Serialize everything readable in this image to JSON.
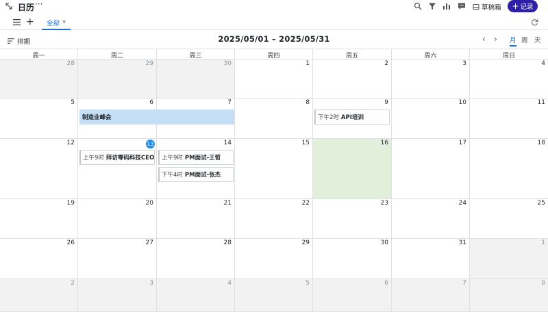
{
  "app": {
    "title": "日历",
    "more": "···"
  },
  "toolbar": {
    "drafts_label": "草稿箱",
    "record_label": "记录",
    "record_plus": "+"
  },
  "tabs": {
    "all_label": "全部",
    "caret": "▼"
  },
  "sortbar": {
    "sort_label": "排期",
    "date_range": "2025/05/01 – 2025/05/31",
    "prev": "‹",
    "next": "›",
    "view_month": "月",
    "view_week": "周",
    "view_day": "天"
  },
  "weekdays": [
    "周一",
    "周二",
    "周三",
    "周四",
    "周五",
    "周六",
    "周日"
  ],
  "weeks": [
    [
      "28",
      "29",
      "30",
      "1",
      "2",
      "3",
      "4"
    ],
    [
      "5",
      "6",
      "7",
      "8",
      "9",
      "10",
      "11"
    ],
    [
      "12",
      "13",
      "14",
      "15",
      "16",
      "17",
      "18"
    ],
    [
      "19",
      "20",
      "21",
      "22",
      "23",
      "24",
      "25"
    ],
    [
      "26",
      "27",
      "28",
      "29",
      "30",
      "31",
      "1"
    ],
    [
      "2",
      "3",
      "4",
      "5",
      "6",
      "7",
      "8"
    ]
  ],
  "events": {
    "summit": {
      "time": "",
      "name": "制造业峰会"
    },
    "api": {
      "time": "下午2时",
      "name": "API培训"
    },
    "visit": {
      "time": "上午9时",
      "name": "拜访零码科技CEO"
    },
    "pm1": {
      "time": "上午9时",
      "name": "PM面试-王哲"
    },
    "pm2": {
      "time": "下午4时",
      "name": "PM面试-张杰"
    }
  },
  "colors": {
    "accent": "#1f6fd6",
    "record_button": "#2f1fa6",
    "today": "#1f8ae6",
    "span_event": "#c6dff6",
    "highlight_day": "#e1efdb"
  }
}
